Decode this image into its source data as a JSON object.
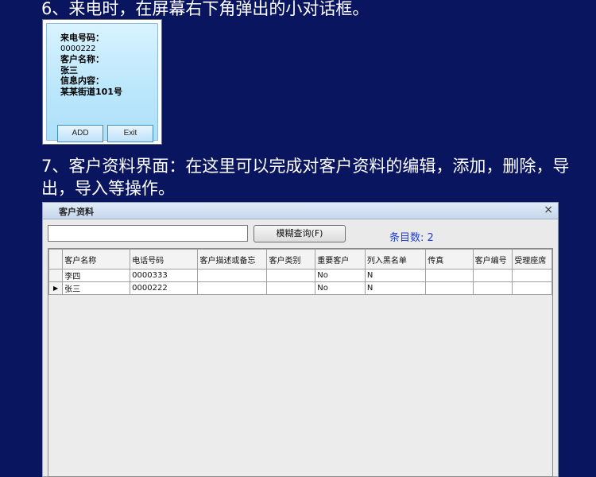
{
  "section6": {
    "heading": "6、来电时，在屏幕右下角弹出的小对话框。"
  },
  "popup": {
    "line1": "来电号码：",
    "line2": "0000222",
    "line3": "客户名称：",
    "line4": "张三",
    "line5": "信息内容：",
    "line6": "某某街道101号",
    "add_label": "ADD",
    "exit_label": "Exit"
  },
  "section7": {
    "heading": "7、客户资料界面：在这里可以完成对客户资料的编辑，添加，删除，导出，导入等操作。"
  },
  "window": {
    "title": "客户资料",
    "close_symbol": "×",
    "search_value": "",
    "search_button": "模糊查询(F)",
    "count_text": "条目数: 2"
  },
  "table": {
    "columns": [
      "客户名称",
      "电话号码",
      "客户描述或备忘",
      "客户类别",
      "重要客户",
      "列入黑名单",
      "传真",
      "客户编号",
      "受理座席"
    ],
    "rows": [
      {
        "cells": [
          "李四",
          "0000333",
          "",
          "",
          "No",
          "N",
          "",
          "",
          ""
        ],
        "selected": false
      },
      {
        "cells": [
          "张三",
          "0000222",
          "",
          "",
          "No",
          "N",
          "",
          "",
          ""
        ],
        "selected": true
      }
    ]
  },
  "colors": {
    "page_background": "#0a1560",
    "count_text": "#1f3fe0",
    "popup_gradient": "#b9e6fb"
  }
}
